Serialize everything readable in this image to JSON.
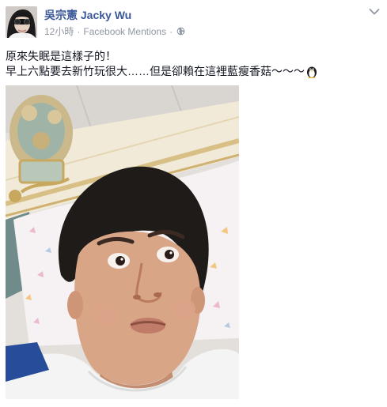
{
  "post": {
    "author": {
      "name": "吳宗憲 Jacky Wu",
      "avatar_icon": "profile-avatar"
    },
    "meta": {
      "time": "12小時",
      "separator": "·",
      "source": "Facebook Mentions",
      "separator2": "·",
      "privacy_icon": "globe-icon"
    },
    "menu_icon": "chevron-down-icon",
    "text": {
      "line1": "原來失眠是這樣子的！",
      "line2": "早上六點要去新竹玩很大……但是卻賴在這裡藍瘦香菇～～～",
      "emoji_icon": "penguin-icon"
    },
    "photo_icon": "selfie-photo"
  },
  "colors": {
    "name": "#3b5998",
    "meta": "#9197a3",
    "text": "#141823"
  }
}
